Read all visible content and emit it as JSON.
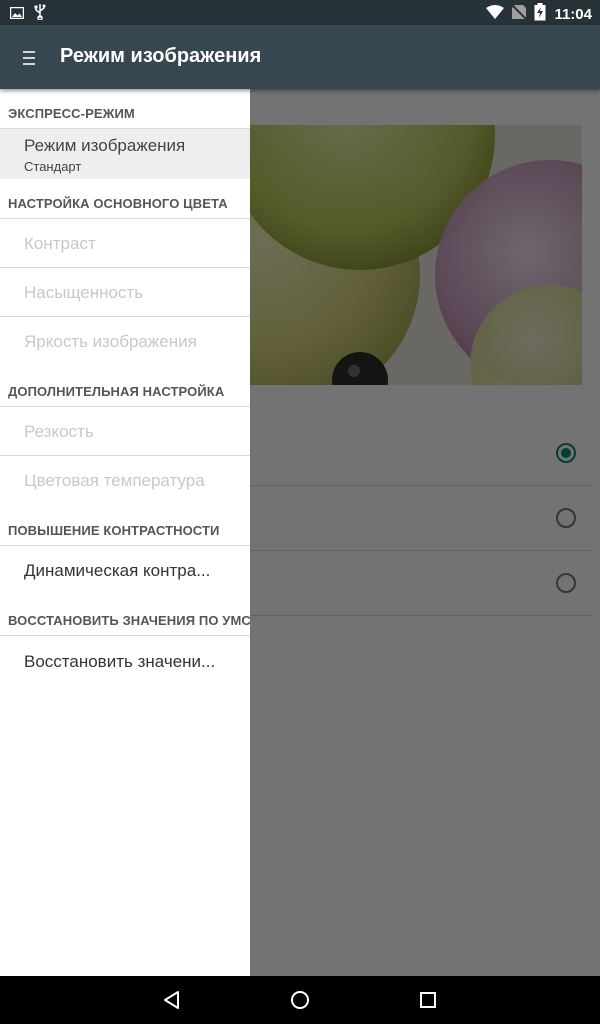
{
  "status_bar": {
    "time": "11:04",
    "icons": [
      "image-notification-icon",
      "usb-icon",
      "wifi-icon",
      "no-sim-icon",
      "battery-charging-icon"
    ]
  },
  "toolbar": {
    "title": "Режим изображения",
    "menu_icon": "menu-icon"
  },
  "drawer": {
    "sections": [
      {
        "header": "ЭКСПРЕСС-РЕЖИМ",
        "items": [
          {
            "label": "Режим изображения",
            "sub": "Стандарт",
            "enabled": true,
            "selected": true
          }
        ]
      },
      {
        "header": "НАСТРОЙКА ОСНОВНОГО ЦВЕТА",
        "items": [
          {
            "label": "Контраст",
            "enabled": false
          },
          {
            "label": "Насыщенность",
            "enabled": false
          },
          {
            "label": "Яркость изображения",
            "enabled": false
          }
        ]
      },
      {
        "header": "ДОПОЛНИТЕЛЬНАЯ НАСТРОЙКА",
        "items": [
          {
            "label": "Резкость",
            "enabled": false
          },
          {
            "label": "Цветовая температура",
            "enabled": false
          }
        ]
      },
      {
        "header": "ПОВЫШЕНИЕ КОНТРАСТНОСТИ",
        "items": [
          {
            "label": "Динамическая контра...",
            "enabled": true
          }
        ]
      },
      {
        "header": "ВОССТАНОВИТЬ ЗНАЧЕНИЯ ПО УМС",
        "items": [
          {
            "label": "Восстановить значени...",
            "enabled": true
          }
        ]
      }
    ]
  },
  "content": {
    "radio_options": [
      {
        "checked": true
      },
      {
        "checked": false
      },
      {
        "checked": false
      }
    ]
  },
  "nav_bar": {
    "icons": [
      "back-icon",
      "home-icon",
      "recents-icon"
    ]
  },
  "colors": {
    "toolbar": "#37474f",
    "status_bar": "#263238",
    "accent": "#00897b"
  }
}
